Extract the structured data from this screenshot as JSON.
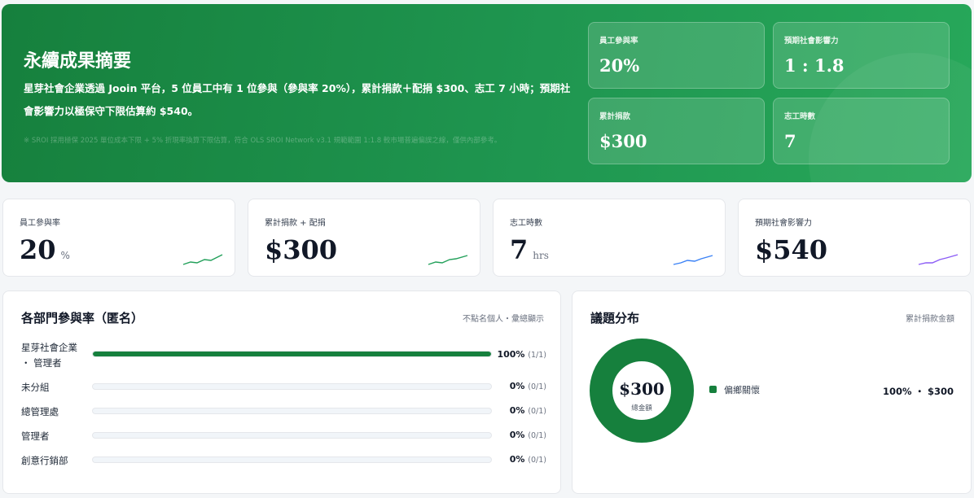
{
  "hero": {
    "title": "永續成果摘要",
    "summary": "星芽社會企業透過 Jooin 平台，5 位員工中有 1 位參與（參與率 20%），累計捐款＋配捐 $300、志工 7 小時；預期社會影響力以極保守下限估算約 $540。",
    "note": "※ SROI 採用極保 2025 單位成本下限 + 5% 折現率換算下限估算，符合 OLS SROI Network v3.1 規範範圍 1:1.8 較市場普遍偏誤之線，僅供內部參考。",
    "cards": [
      {
        "label": "員工參與率",
        "value": "20%"
      },
      {
        "label": "預期社會影響力",
        "value": "1 : 1.8"
      },
      {
        "label": "累計捐款",
        "value": "$300"
      },
      {
        "label": "志工時數",
        "value": "7"
      }
    ]
  },
  "kpis": [
    {
      "label": "員工參與率",
      "value": "20",
      "unit": "%",
      "spark_color": "#22a05a"
    },
    {
      "label": "累計捐款 + 配捐",
      "value": "$300",
      "unit": "",
      "spark_color": "#22a05a"
    },
    {
      "label": "志工時數",
      "value": "7",
      "unit": "hrs",
      "spark_color": "#3b82f6"
    },
    {
      "label": "預期社會影響力",
      "value": "$540",
      "unit": "",
      "spark_color": "#8b5cf6"
    }
  ],
  "departments": {
    "title": "各部門參與率（匿名）",
    "subtitle": "不點名個人・彙總顯示",
    "rows": [
      {
        "name_line1": "星芽社會企業",
        "name_line2": "・ 管理者",
        "pct": "100%",
        "count": "(1/1)",
        "fill": 1.0
      },
      {
        "name_line1": "未分組",
        "name_line2": "",
        "pct": "0%",
        "count": "(0/1)",
        "fill": 0
      },
      {
        "name_line1": "總管理處",
        "name_line2": "",
        "pct": "0%",
        "count": "(0/1)",
        "fill": 0
      },
      {
        "name_line1": "管理者",
        "name_line2": "",
        "pct": "0%",
        "count": "(0/1)",
        "fill": 0
      },
      {
        "name_line1": "創意行銷部",
        "name_line2": "",
        "pct": "0%",
        "count": "(0/1)",
        "fill": 0
      }
    ]
  },
  "issues": {
    "title": "議題分布",
    "subtitle": "累計捐款金額",
    "total_value": "$300",
    "total_label": "總金額",
    "legend": [
      {
        "name": "偏鄉關懷",
        "value": "100% ・ $300",
        "color": "#16803d",
        "share": 1.0
      }
    ]
  }
}
